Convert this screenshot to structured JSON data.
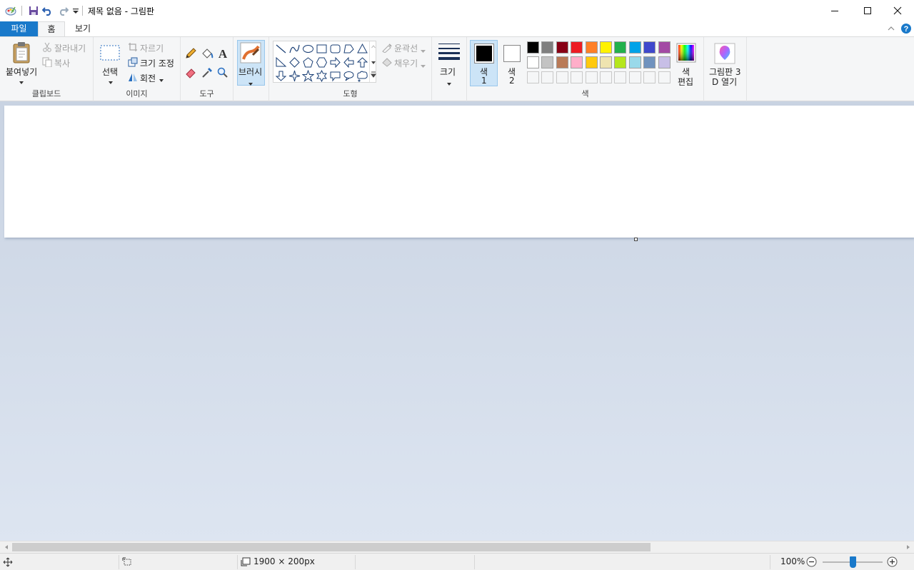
{
  "window": {
    "title": "제목 없음 - 그림판"
  },
  "tabs": {
    "file": "파일",
    "home": "홈",
    "view": "보기"
  },
  "clipboard": {
    "paste": "붙여넣기",
    "cut": "잘라내기",
    "copy": "복사",
    "group": "클립보드"
  },
  "image": {
    "select": "선택",
    "crop": "자르기",
    "resize": "크기 조정",
    "rotate": "회전",
    "group": "이미지"
  },
  "tools": {
    "group": "도구"
  },
  "brushes": {
    "label": "브러시"
  },
  "shapes": {
    "outline": "윤곽선",
    "fill": "채우기",
    "group": "도형"
  },
  "size": {
    "label": "크기"
  },
  "colors": {
    "color1_a": "색",
    "color1_b": "1",
    "color2_a": "색",
    "color2_b": "2",
    "edit_a": "색",
    "edit_b": "편집",
    "group": "색",
    "color1_value": "#000000",
    "color2_value": "#ffffff",
    "palette_row1": [
      "#000000",
      "#7f7f7f",
      "#880015",
      "#ed1c24",
      "#ff7f27",
      "#fff200",
      "#22b14c",
      "#00a2e8",
      "#3f48cc",
      "#a349a4"
    ],
    "palette_row2": [
      "#ffffff",
      "#c3c3c3",
      "#b97a57",
      "#ffaec9",
      "#ffc90e",
      "#efe4b0",
      "#b5e61d",
      "#99d9ea",
      "#7092be",
      "#c8bfe7"
    ]
  },
  "paint3d": {
    "line1": "그림판 3",
    "line2": "D 열기"
  },
  "status": {
    "dimensions": "1900 × 200px",
    "zoom": "100%",
    "zoom_level": 0.5
  }
}
